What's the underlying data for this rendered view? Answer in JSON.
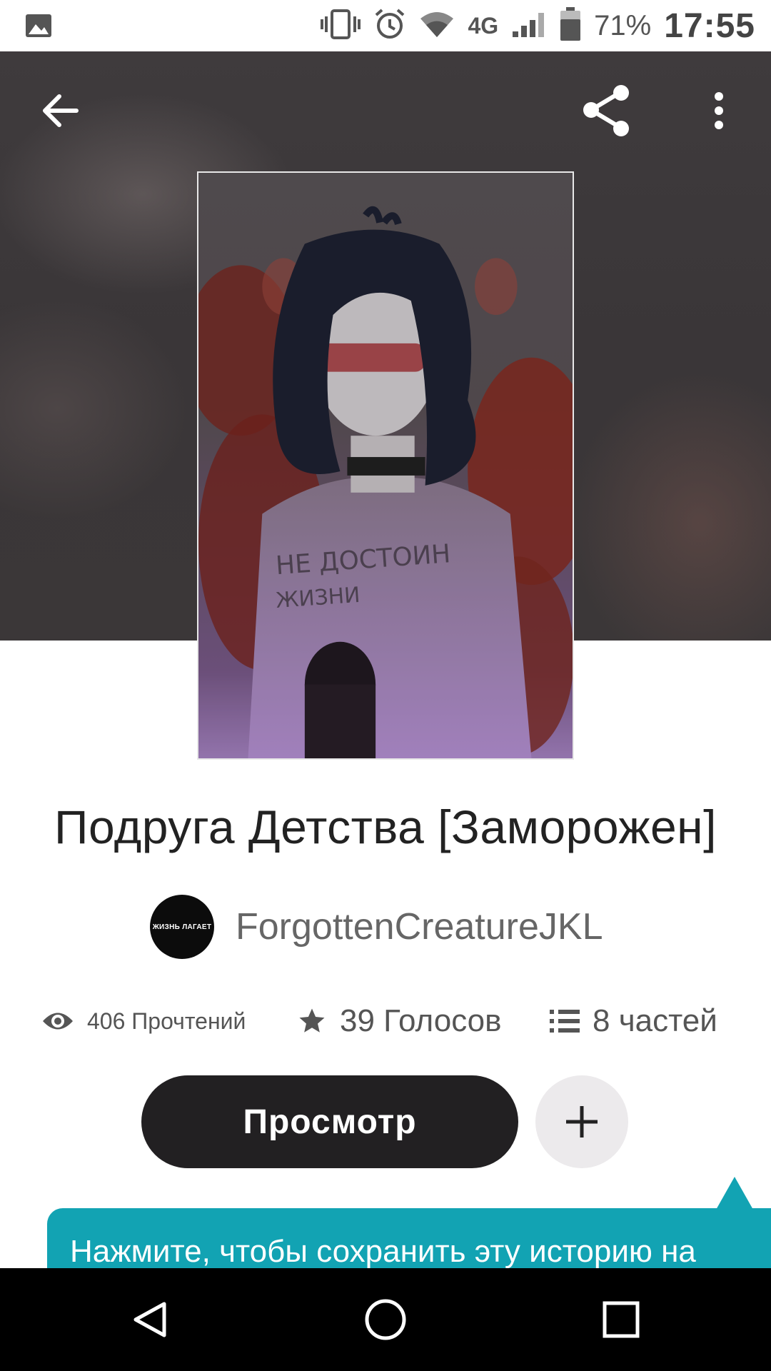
{
  "status_bar": {
    "battery": "71%",
    "network": "4G",
    "time": "17:55",
    "icons": [
      "gallery-icon",
      "vibrate-icon",
      "alarm-icon",
      "wifi-icon",
      "signal-icon",
      "battery-icon"
    ]
  },
  "header": {
    "icons": [
      "back-arrow-icon",
      "share-icon",
      "more-vert-icon"
    ]
  },
  "cover": {
    "shirt_text_line1": "НЕ ДОСТОИН",
    "shirt_text_line2": "ЖИЗНИ"
  },
  "story": {
    "title": "Подруга Детства [Заморожен]"
  },
  "author": {
    "avatar_text": "ЖИЗНЬ ЛАГАЕТ",
    "name": "ForgottenCreatureJKL"
  },
  "stats": {
    "reads": "406 Прочтений",
    "votes": "39 Голосов",
    "parts": "8 частей"
  },
  "actions": {
    "read_label": "Просмотр",
    "add_icon": "plus-icon"
  },
  "tooltip": {
    "text": "Нажмите, чтобы сохранить эту историю на"
  },
  "nav_bar": {
    "icons": [
      "nav-back-icon",
      "nav-home-icon",
      "nav-recents-icon"
    ]
  },
  "colors": {
    "accent_teal": "#12a3b3",
    "button_dark": "#222022",
    "header_bg": "#3c383a"
  }
}
